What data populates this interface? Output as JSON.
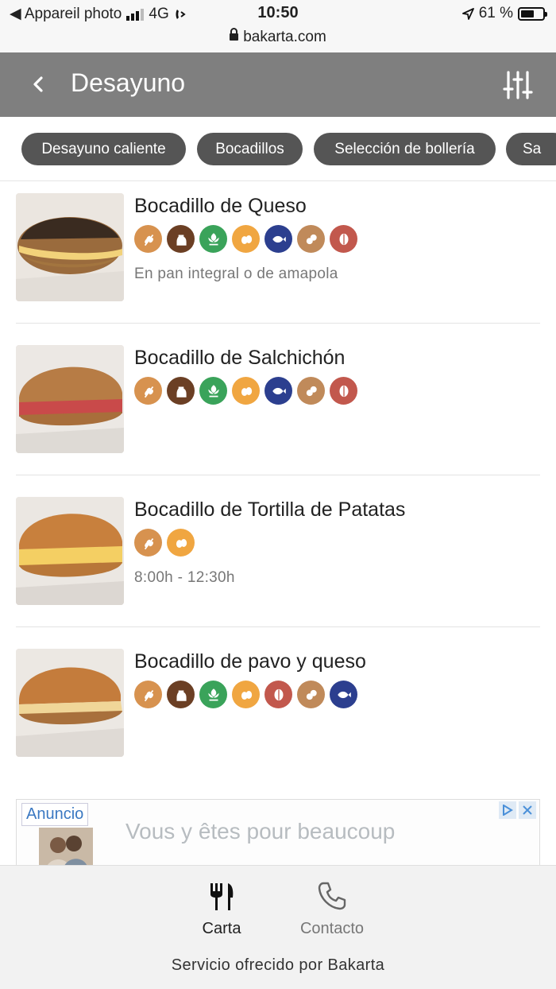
{
  "status_bar": {
    "back_app": "◀ Appareil photo",
    "network": "4G",
    "time": "10:50",
    "battery_text": "61 %",
    "battery_level": 0.61
  },
  "url_bar": {
    "url": "bakarta.com"
  },
  "header": {
    "title": "Desayuno",
    "back_icon": "chevron-left-icon",
    "filter_icon": "sliders-icon"
  },
  "categories": [
    {
      "label": "Desayuno caliente"
    },
    {
      "label": "Bocadillos"
    },
    {
      "label": "Selección de bollería"
    },
    {
      "label": "Sa"
    }
  ],
  "allergen_types": {
    "gluten": {
      "color": "#d7924f",
      "icon": "wheat-icon"
    },
    "milk": {
      "color": "#6b3f24",
      "icon": "milk-jug-icon"
    },
    "celery": {
      "color": "#3aa35a",
      "icon": "celery-icon"
    },
    "egg": {
      "color": "#f0a641",
      "icon": "egg-icon"
    },
    "fish": {
      "color": "#2c3f8f",
      "icon": "fish-icon"
    },
    "peanut": {
      "color": "#c08a5a",
      "icon": "peanut-icon"
    },
    "nuts": {
      "color": "#c2584d",
      "icon": "nut-icon"
    }
  },
  "items": [
    {
      "name": "Bocadillo de Queso",
      "allergens": [
        "gluten",
        "milk",
        "celery",
        "egg",
        "fish",
        "peanut",
        "nuts"
      ],
      "description": "En pan integral o de amapola"
    },
    {
      "name": "Bocadillo de Salchichón",
      "allergens": [
        "gluten",
        "milk",
        "celery",
        "egg",
        "fish",
        "peanut",
        "nuts"
      ],
      "description": ""
    },
    {
      "name": "Bocadillo de Tortilla de Patatas",
      "allergens": [
        "gluten",
        "egg"
      ],
      "description": "8:00h - 12:30h"
    },
    {
      "name": "Bocadillo de pavo y queso",
      "allergens": [
        "gluten",
        "milk",
        "celery",
        "egg",
        "nuts",
        "peanut",
        "fish"
      ],
      "description": ""
    }
  ],
  "ad": {
    "label": "Anuncio",
    "text": "Vous y êtes pour beaucoup"
  },
  "footer": {
    "tabs": [
      {
        "label": "Carta",
        "icon": "fork-knife-icon"
      },
      {
        "label": "Contacto",
        "icon": "phone-icon"
      }
    ],
    "credit": "Servicio ofrecido por Bakarta"
  }
}
